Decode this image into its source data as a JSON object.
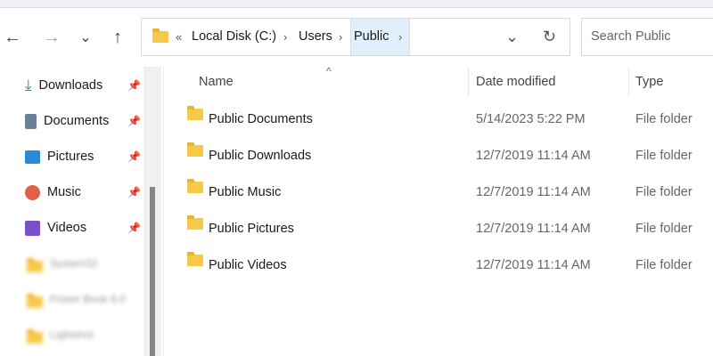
{
  "nav": {
    "back": "←",
    "forward": "→",
    "recent": "⌄",
    "up": "↑"
  },
  "address": {
    "overflow": "«",
    "crumbs": [
      "Local Disk (C:)",
      "Users",
      "Public"
    ],
    "sep": "›",
    "dropdown": "⌄",
    "refresh": "↻"
  },
  "search": {
    "placeholder": "Search Public"
  },
  "sidebar": {
    "items": [
      {
        "label": "Downloads",
        "icon": "download-icon",
        "pinned": true
      },
      {
        "label": "Documents",
        "icon": "document-icon",
        "pinned": true
      },
      {
        "label": "Pictures",
        "icon": "pictures-icon",
        "pinned": true
      },
      {
        "label": "Music",
        "icon": "music-icon",
        "pinned": true
      },
      {
        "label": "Videos",
        "icon": "videos-icon",
        "pinned": true
      },
      {
        "label": "System32",
        "icon": "folder-icon"
      },
      {
        "label": "Power Book 8.0",
        "icon": "folder-icon"
      },
      {
        "label": "Lightshot",
        "icon": "folder-icon"
      }
    ]
  },
  "columns": {
    "name": "Name",
    "date": "Date modified",
    "type": "Type",
    "sort": "^"
  },
  "files": [
    {
      "name": "Public Documents",
      "date": "5/14/2023 5:22 PM",
      "type": "File folder"
    },
    {
      "name": "Public Downloads",
      "date": "12/7/2019 11:14 AM",
      "type": "File folder"
    },
    {
      "name": "Public Music",
      "date": "12/7/2019 11:14 AM",
      "type": "File folder"
    },
    {
      "name": "Public Pictures",
      "date": "12/7/2019 11:14 AM",
      "type": "File folder"
    },
    {
      "name": "Public Videos",
      "date": "12/7/2019 11:14 AM",
      "type": "File folder"
    }
  ]
}
